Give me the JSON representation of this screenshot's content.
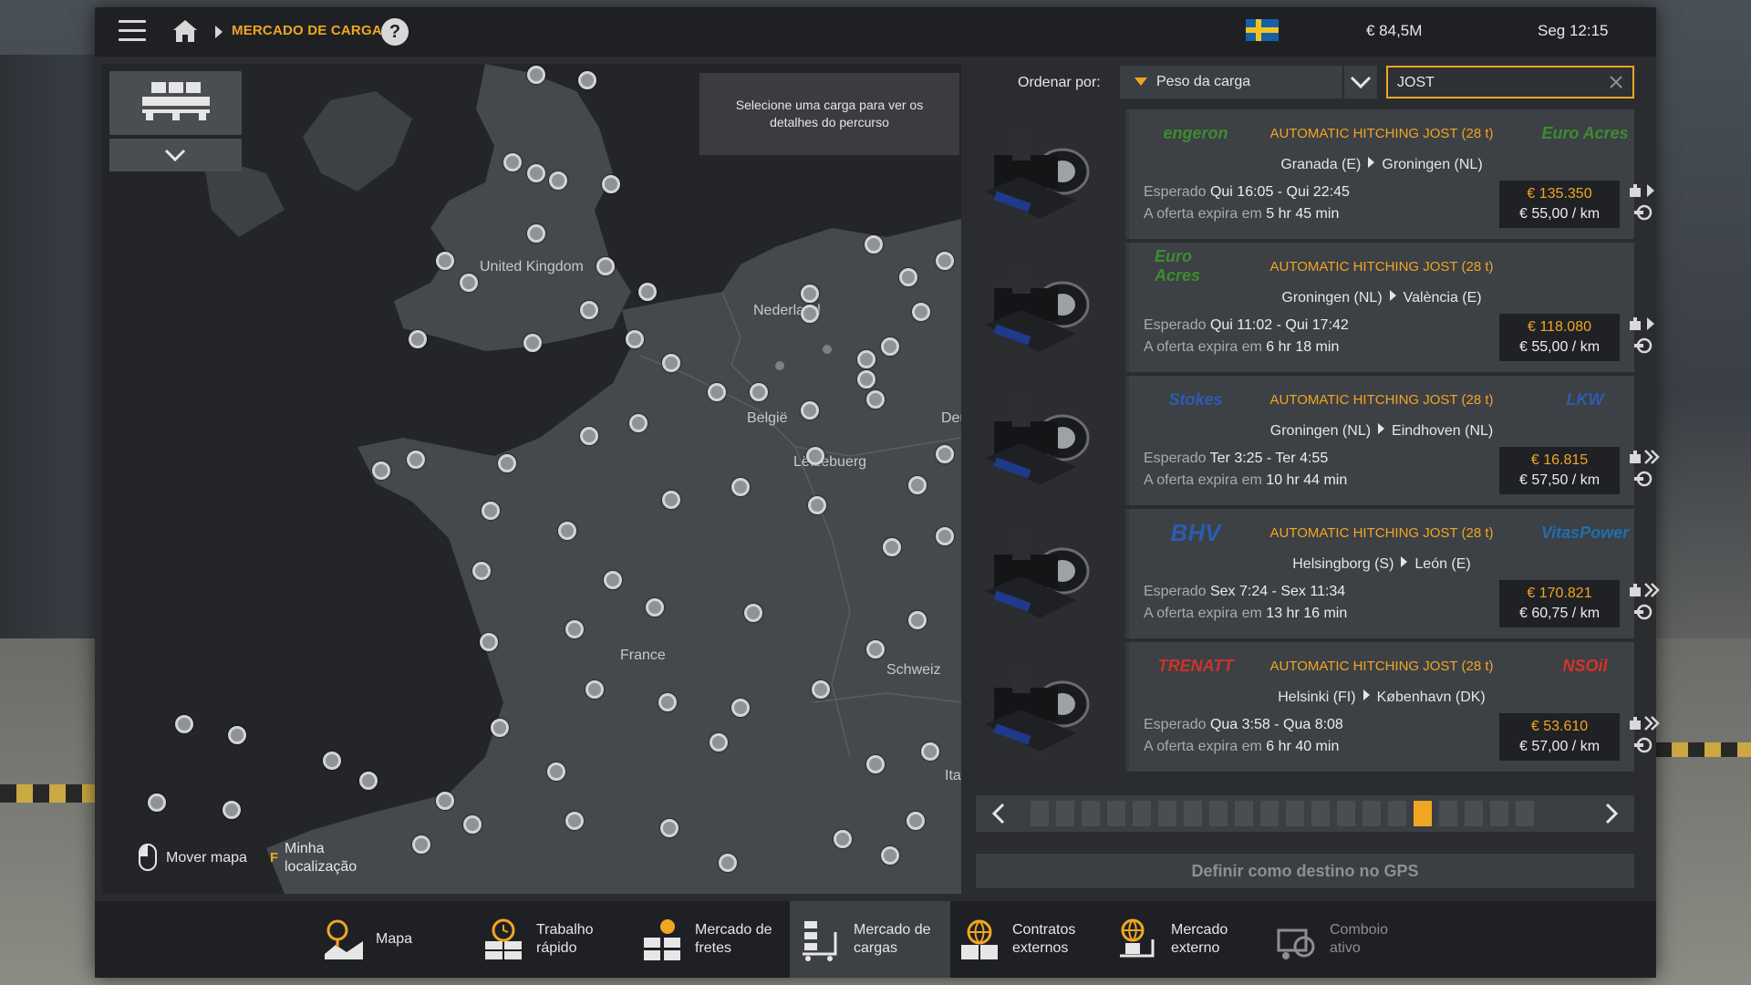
{
  "topbar": {
    "breadcrumb": "MERCADO DE CARGAS",
    "help": "?",
    "money": "€ 84,5M",
    "clock": "Seg 12:15"
  },
  "map": {
    "labels": [
      {
        "text": "United Kingdom"
      },
      {
        "text": "Nederland"
      },
      {
        "text": "België"
      },
      {
        "text": "Lëtzebuerg"
      },
      {
        "text": "Deu"
      },
      {
        "text": "France"
      },
      {
        "text": "Schweiz"
      },
      {
        "text": "Ita"
      }
    ],
    "route_hint": "Selecione uma carga para ver os detalhes do percurso",
    "hint_move": "Mover mapa",
    "hint_key": "F",
    "hint_location_1": "Minha",
    "hint_location_2": "localização"
  },
  "sort": {
    "label": "Ordenar por:",
    "selected": "Peso da carga"
  },
  "search": {
    "value": "JOST",
    "placeholder": ""
  },
  "jobs": [
    {
      "title": "AUTOMATIC HITCHING JOST (28 t)",
      "from": "Granada (E)",
      "to": "Groningen (NL)",
      "expected_label": "Esperado",
      "expected": "Qui 16:05 - Qui 22:45",
      "expires_label": "A oferta expira em",
      "expires": "5 hr 45 min",
      "price": "€ 135.350",
      "per_km": "€ 55,00 / km",
      "logo_left": "engeron",
      "logo_right_1": "Euro",
      "logo_right_2": "Acres"
    },
    {
      "title": "AUTOMATIC HITCHING JOST (28 t)",
      "from": "Groningen (NL)",
      "to": "València (E)",
      "expected_label": "Esperado",
      "expected": "Qui 11:02 - Qui 17:42",
      "expires_label": "A oferta expira em",
      "expires": "6 hr 18 min",
      "price": "€ 118.080",
      "per_km": "€ 55,00 / km",
      "logo_left_1": "Euro",
      "logo_left_2": "Acres",
      "logo_right": ""
    },
    {
      "title": "AUTOMATIC HITCHING JOST (28 t)",
      "from": "Groningen (NL)",
      "to": "Eindhoven (NL)",
      "expected_label": "Esperado",
      "expected": "Ter 3:25 - Ter 4:55",
      "expires_label": "A oferta expira em",
      "expires": "10 hr 44 min",
      "price": "€ 16.815",
      "per_km": "€ 57,50 / km",
      "logo_left": "Stokes",
      "logo_right": "LKW"
    },
    {
      "title": "AUTOMATIC HITCHING JOST (28 t)",
      "from": "Helsingborg (S)",
      "to": "León (E)",
      "expected_label": "Esperado",
      "expected": "Sex 7:24 - Sex 11:34",
      "expires_label": "A oferta expira em",
      "expires": "13 hr 16 min",
      "price": "€ 170.821",
      "per_km": "€ 60,75 / km",
      "logo_left": "BHV",
      "logo_right": "VitasPower"
    },
    {
      "title": "AUTOMATIC HITCHING JOST (28 t)",
      "from": "Helsinki (FI)",
      "to": "København (DK)",
      "expected_label": "Esperado",
      "expected": "Qua 3:58 - Qua 8:08",
      "expires_label": "A oferta expira em",
      "expires": "6 hr 40 min",
      "price": "€ 53.610",
      "per_km": "€ 57,00 / km",
      "logo_left": "TRENATT",
      "logo_right": "NSOil"
    }
  ],
  "pager": {
    "pages": 20,
    "active_page": 16
  },
  "gps_button": "Definir como destino no GPS",
  "nav": [
    {
      "label_1": "Mapa",
      "label_2": ""
    },
    {
      "label_1": "Trabalho",
      "label_2": "rápido"
    },
    {
      "label_1": "Mercado de",
      "label_2": "fretes"
    },
    {
      "label_1": "Mercado de",
      "label_2": "cargas"
    },
    {
      "label_1": "Contratos",
      "label_2": "externos"
    },
    {
      "label_1": "Mercado",
      "label_2": "externo"
    },
    {
      "label_1": "Comboio",
      "label_2": "ativo"
    }
  ],
  "colors": {
    "accent": "#f0a623",
    "panel": "#3d4044",
    "dark": "#1e2024"
  }
}
